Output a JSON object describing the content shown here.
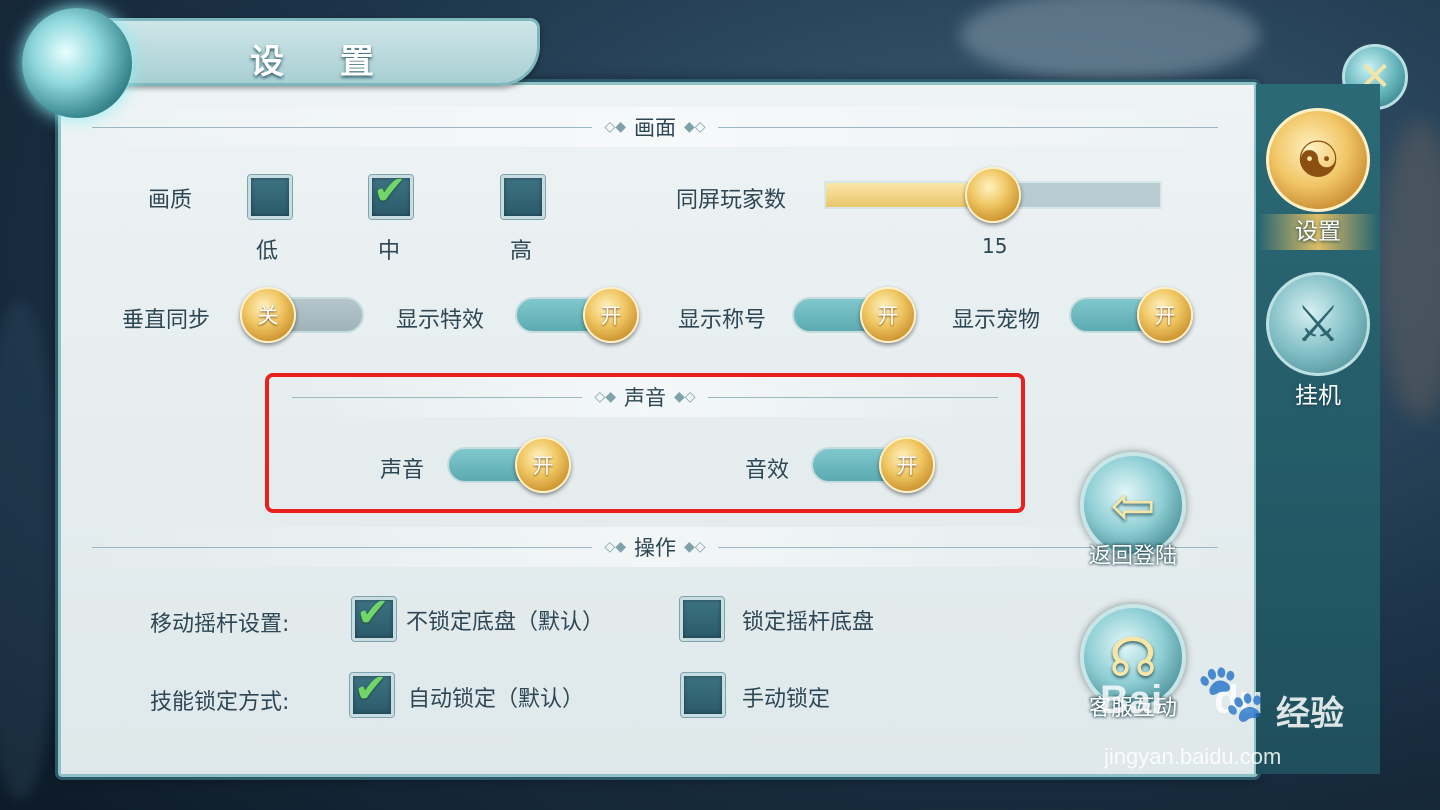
{
  "window": {
    "title": "设 置"
  },
  "sections": {
    "graphics": "画面",
    "sound": "声音",
    "controls": "操作"
  },
  "graphics": {
    "quality_label": "画质",
    "quality_options": [
      {
        "label": "低",
        "checked": false
      },
      {
        "label": "中",
        "checked": true
      },
      {
        "label": "高",
        "checked": false
      }
    ],
    "players_label": "同屏玩家数",
    "players_value": "15",
    "players_fraction": 0.5,
    "toggles": [
      {
        "label": "垂直同步",
        "state": "关",
        "on": false
      },
      {
        "label": "显示特效",
        "state": "开",
        "on": true
      },
      {
        "label": "显示称号",
        "state": "开",
        "on": true
      },
      {
        "label": "显示宠物",
        "state": "开",
        "on": true
      }
    ]
  },
  "sound": {
    "toggles": [
      {
        "label": "声音",
        "state": "开",
        "on": true
      },
      {
        "label": "音效",
        "state": "开",
        "on": true
      }
    ]
  },
  "controls": {
    "joystick_label": "移动摇杆设置:",
    "joystick_options": [
      {
        "label": "不锁定底盘（默认）",
        "checked": true
      },
      {
        "label": "锁定摇杆底盘",
        "checked": false
      }
    ],
    "skill_label": "技能锁定方式:",
    "skill_options": [
      {
        "label": "自动锁定（默认）",
        "checked": true
      },
      {
        "label": "手动锁定",
        "checked": false
      }
    ]
  },
  "side_tabs": [
    {
      "label": "设置",
      "icon": "yin-yang-gear-icon",
      "active": true
    },
    {
      "label": "挂机",
      "icon": "crossed-swords-icon",
      "active": false
    }
  ],
  "actions": {
    "return_login": "返回登陆",
    "customer_service": "客服互动"
  },
  "watermark": {
    "brand": "Bai",
    "brand2": "du",
    "jingyan": "经验",
    "url": "jingyan.baidu.com"
  },
  "colors": {
    "highlight": "#e8211e",
    "toggle_on": "#5daab2",
    "knob_gold": "#f0c764",
    "check_green": "#71d66a"
  }
}
